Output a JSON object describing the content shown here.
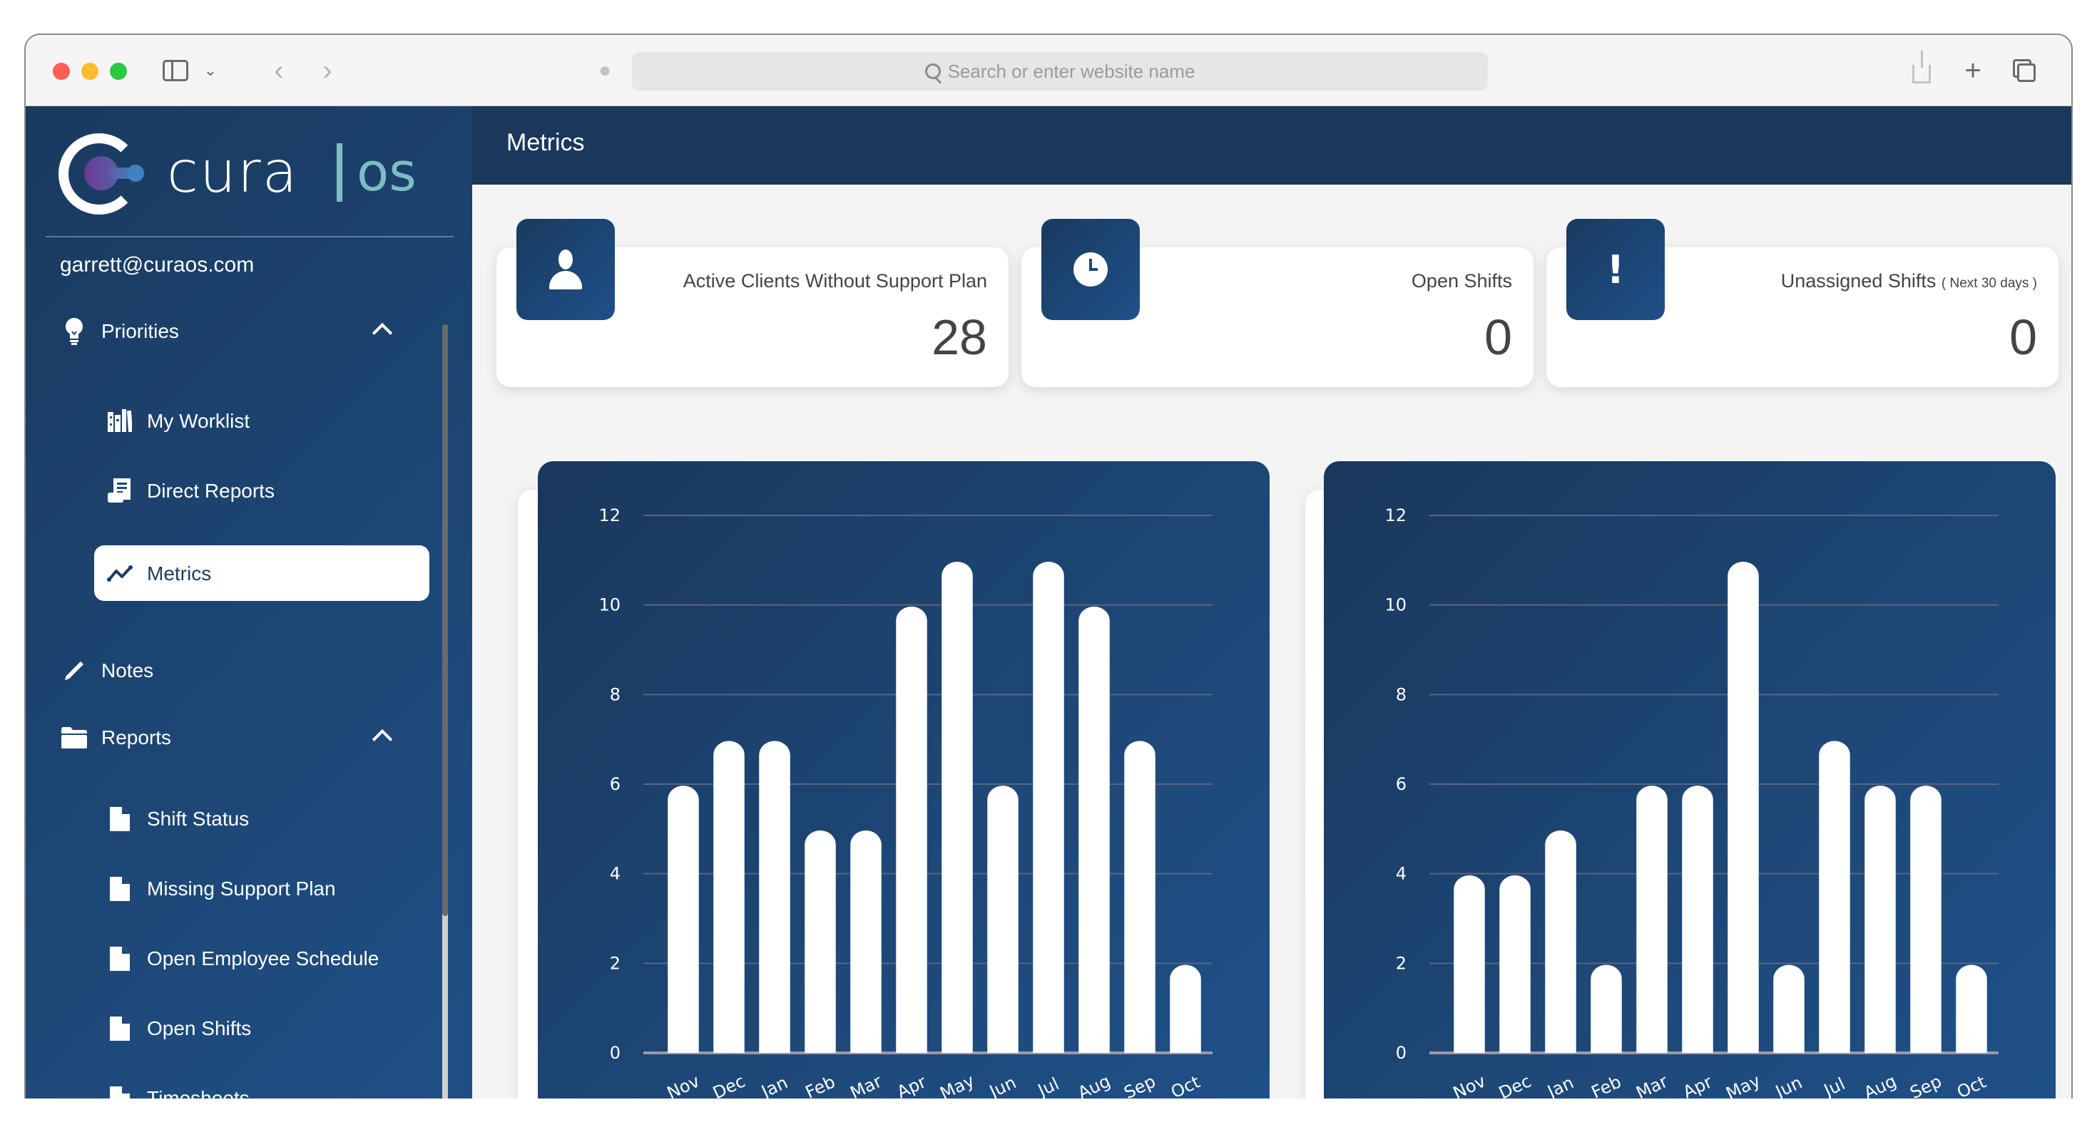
{
  "browser": {
    "url_placeholder": "Search or enter website name",
    "icons": [
      "sidebar-toggle-icon",
      "chevron-down-icon",
      "back-icon",
      "forward-icon",
      "evernote-extension-icon",
      "search-icon",
      "share-icon",
      "new-tab-icon",
      "tab-overview-icon"
    ]
  },
  "brand": {
    "name": "cura",
    "suffix": "os"
  },
  "user": {
    "email": "garrett@curaos.com"
  },
  "sidebar": {
    "sections": [
      {
        "label": "Priorities",
        "icon": "lightbulb-icon",
        "expanded": true,
        "items": [
          {
            "label": "My Worklist",
            "icon": "worklist-icon",
            "active": false
          },
          {
            "label": "Direct Reports",
            "icon": "direct-reports-icon",
            "active": false
          },
          {
            "label": "Metrics",
            "icon": "trend-line-icon",
            "active": true
          }
        ]
      },
      {
        "label": "Notes",
        "icon": "pencil-icon",
        "expanded": false,
        "items": []
      },
      {
        "label": "Reports",
        "icon": "folder-icon",
        "expanded": true,
        "items": [
          {
            "label": "Shift Status",
            "icon": "file-icon"
          },
          {
            "label": "Missing Support Plan",
            "icon": "file-icon"
          },
          {
            "label": "Open Employee Schedule",
            "icon": "file-icon"
          },
          {
            "label": "Open Shifts",
            "icon": "file-icon"
          },
          {
            "label": "Timesheets",
            "icon": "file-icon"
          }
        ]
      }
    ]
  },
  "page": {
    "title": "Metrics"
  },
  "cards": [
    {
      "label": "Active Clients Without Support Plan",
      "sublabel": "",
      "value": "28",
      "icon": "person-icon"
    },
    {
      "label": "Open Shifts",
      "sublabel": "",
      "value": "0",
      "icon": "clock-icon"
    },
    {
      "label": "Unassigned Shifts",
      "sublabel": "( Next 30 days )",
      "value": "0",
      "icon": "exclamation-icon"
    }
  ],
  "colors": {
    "sidebar_bg": "#1d4776",
    "header_bg": "#1a375c",
    "logo_accent": "#7ebcc5",
    "text_dark": "#444444"
  },
  "chart_data": [
    {
      "type": "bar",
      "title": "",
      "xlabel": "",
      "ylabel": "",
      "categories": [
        "Nov",
        "Dec",
        "Jan",
        "Feb",
        "Mar",
        "Apr",
        "May",
        "Jun",
        "Jul",
        "Aug",
        "Sep",
        "Oct"
      ],
      "values": [
        6,
        7,
        7,
        5,
        5,
        10,
        11,
        6,
        11,
        10,
        7,
        2
      ],
      "yticks": [
        0,
        2,
        4,
        6,
        8,
        10,
        12
      ],
      "ylim": [
        0,
        12
      ],
      "grid": true,
      "legend": "none"
    },
    {
      "type": "bar",
      "title": "",
      "xlabel": "",
      "ylabel": "",
      "categories": [
        "Nov",
        "Dec",
        "Jan",
        "Feb",
        "Mar",
        "Apr",
        "May",
        "Jun",
        "Jul",
        "Aug",
        "Sep",
        "Oct"
      ],
      "values": [
        4,
        4,
        5,
        2,
        6,
        6,
        11,
        2,
        7,
        6,
        6,
        2
      ],
      "yticks": [
        0,
        2,
        4,
        6,
        8,
        10,
        12
      ],
      "ylim": [
        0,
        12
      ],
      "grid": true,
      "legend": "none"
    }
  ]
}
